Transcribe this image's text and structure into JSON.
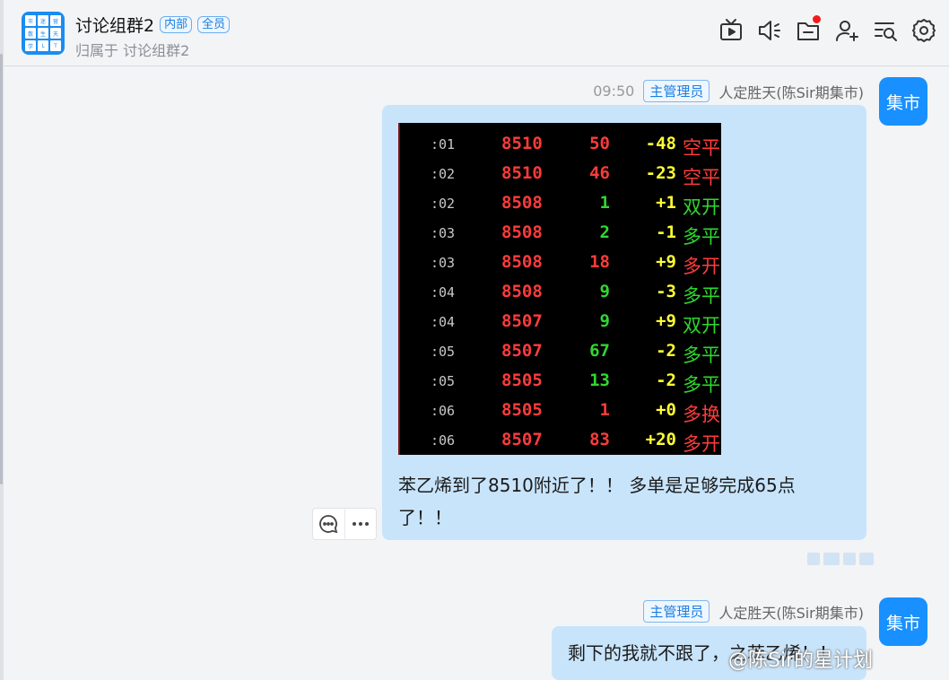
{
  "header": {
    "group_title": "讨论组群2",
    "tags": [
      "内部",
      "全员"
    ],
    "subtitle": "归属于 讨论组群2",
    "avatar_chars": [
      "市",
      "迷",
      "营",
      "散",
      "生",
      "天",
      "学",
      "L",
      "T"
    ],
    "toolbar_icons": [
      "tv-icon",
      "speaker-icon",
      "folder-icon",
      "add-user-icon",
      "search-list-icon",
      "gear-icon"
    ]
  },
  "messages": [
    {
      "time": "09:50",
      "role": "主管理员",
      "sender": "人定胜天(陈Sir期集市)",
      "avatar_text": "集市",
      "text_line1": "苯乙烯到了8510附近了！！ 多单是足够完成65点",
      "text_line2": "了！！",
      "stock_rows": [
        {
          "time": ":01",
          "price": "8510",
          "vol": "50",
          "chg": "-48",
          "type": "空平",
          "vol_color": "red",
          "type_color": "red"
        },
        {
          "time": ":02",
          "price": "8510",
          "vol": "46",
          "chg": "-23",
          "type": "空平",
          "vol_color": "red",
          "type_color": "red"
        },
        {
          "time": ":02",
          "price": "8508",
          "vol": "1",
          "chg": "+1",
          "type": "双开",
          "vol_color": "green",
          "type_color": "green"
        },
        {
          "time": ":03",
          "price": "8508",
          "vol": "2",
          "chg": "-1",
          "type": "多平",
          "vol_color": "green",
          "type_color": "green"
        },
        {
          "time": ":03",
          "price": "8508",
          "vol": "18",
          "chg": "+9",
          "type": "多开",
          "vol_color": "red",
          "type_color": "red"
        },
        {
          "time": ":04",
          "price": "8508",
          "vol": "9",
          "chg": "-3",
          "type": "多平",
          "vol_color": "green",
          "type_color": "green"
        },
        {
          "time": ":04",
          "price": "8507",
          "vol": "9",
          "chg": "+9",
          "type": "双开",
          "vol_color": "green",
          "type_color": "green"
        },
        {
          "time": ":05",
          "price": "8507",
          "vol": "67",
          "chg": "-2",
          "type": "多平",
          "vol_color": "green",
          "type_color": "green"
        },
        {
          "time": ":05",
          "price": "8505",
          "vol": "13",
          "chg": "-2",
          "type": "多平",
          "vol_color": "green",
          "type_color": "green"
        },
        {
          "time": ":06",
          "price": "8505",
          "vol": "1",
          "chg": "+0",
          "type": "多换",
          "vol_color": "red",
          "type_color": "red"
        },
        {
          "time": ":06",
          "price": "8507",
          "vol": "83",
          "chg": "+20",
          "type": "多开",
          "vol_color": "red",
          "type_color": "red"
        }
      ]
    },
    {
      "role": "主管理员",
      "sender": "人定胜天(陈Sir期集市)",
      "avatar_text": "集市",
      "text": "剩下的我就不跟了，之苯乙烯！！"
    }
  ],
  "watermark": "@陈Sir的星计划",
  "colors": {
    "accent": "#1890ff",
    "bubble": "#c8e4fb",
    "badge_dot": "#f21b1b"
  }
}
